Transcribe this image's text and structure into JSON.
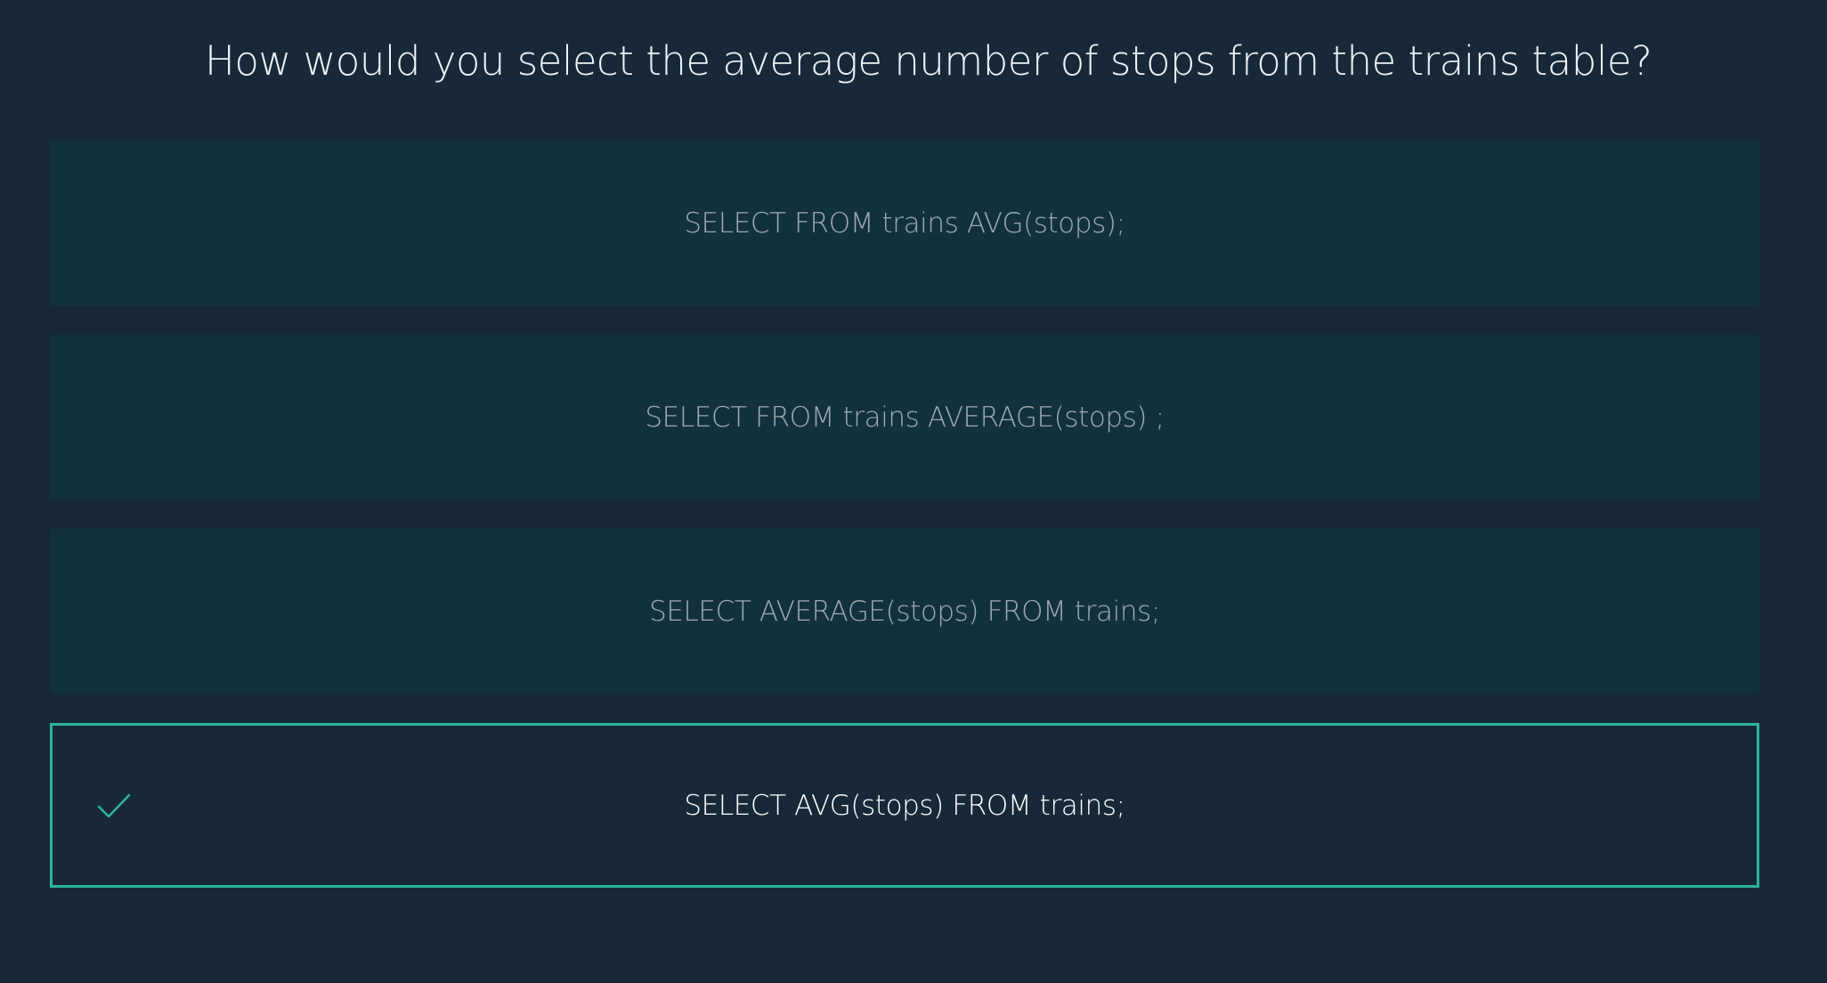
{
  "quiz": {
    "question": "How would you select the average number of stops from the trains table?",
    "choices": [
      {
        "label": "SELECT FROM trains AVG(stops);",
        "state": "unselected"
      },
      {
        "label": "SELECT FROM trains AVERAGE(stops) ;",
        "state": "unselected"
      },
      {
        "label": "SELECT AVERAGE(stops) FROM trains;",
        "state": "unselected"
      },
      {
        "label": "SELECT AVG(stops) FROM trains;",
        "state": "correct",
        "icon": "check-icon"
      }
    ]
  },
  "colors": {
    "background": "#172938",
    "choice_background": "#12313f",
    "accent": "#2fb59b",
    "question_text": "#eef3f6",
    "choice_text": "#9fabb3",
    "selected_text": "#ffffff"
  }
}
